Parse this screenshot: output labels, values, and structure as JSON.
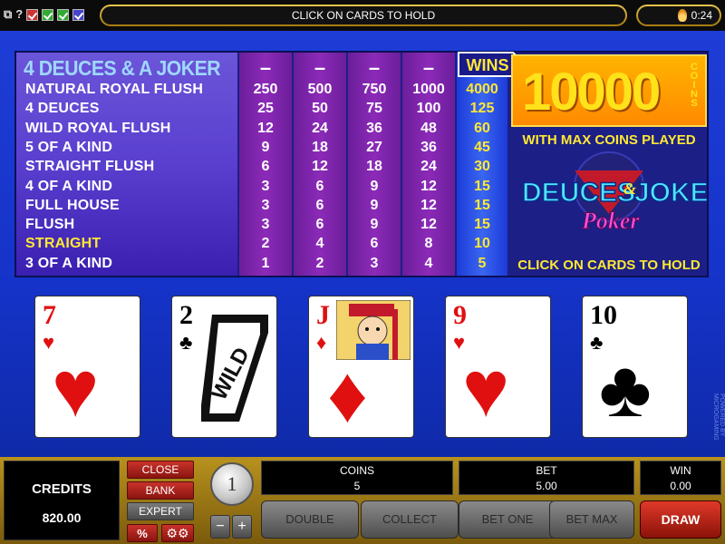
{
  "topbar": {
    "help_label": "?",
    "message": "CLICK ON CARDS TO HOLD",
    "time": "0:24"
  },
  "paytable": {
    "title": "4 DEUCES & A JOKER",
    "dash": "–",
    "wins_label": "WINS",
    "rows": [
      {
        "hand": "NATURAL ROYAL FLUSH",
        "c1": "250",
        "c2": "500",
        "c3": "750",
        "c4": "1000",
        "win": "4000"
      },
      {
        "hand": "4 DEUCES",
        "c1": "25",
        "c2": "50",
        "c3": "75",
        "c4": "100",
        "win": "125"
      },
      {
        "hand": "WILD ROYAL FLUSH",
        "c1": "12",
        "c2": "24",
        "c3": "36",
        "c4": "48",
        "win": "60"
      },
      {
        "hand": "5 OF A KIND",
        "c1": "9",
        "c2": "18",
        "c3": "27",
        "c4": "36",
        "win": "45"
      },
      {
        "hand": "STRAIGHT FLUSH",
        "c1": "6",
        "c2": "12",
        "c3": "18",
        "c4": "24",
        "win": "30"
      },
      {
        "hand": "4 OF A KIND",
        "c1": "3",
        "c2": "6",
        "c3": "9",
        "c4": "12",
        "win": "15"
      },
      {
        "hand": "FULL HOUSE",
        "c1": "3",
        "c2": "6",
        "c3": "9",
        "c4": "12",
        "win": "15"
      },
      {
        "hand": "FLUSH",
        "c1": "3",
        "c2": "6",
        "c3": "9",
        "c4": "12",
        "win": "15"
      },
      {
        "hand": "STRAIGHT",
        "c1": "2",
        "c2": "4",
        "c3": "6",
        "c4": "8",
        "win": "10"
      },
      {
        "hand": "3 OF A KIND",
        "c1": "1",
        "c2": "2",
        "c3": "3",
        "c4": "4",
        "win": "5"
      }
    ],
    "highlight_color": "#ffe833"
  },
  "side": {
    "jackpot": "10000",
    "coins_word": "COINS",
    "max_coins": "WITH MAX COINS PLAYED",
    "logo_line1": "DEUCES",
    "logo_amp": "&",
    "logo_line2": "JOKER",
    "logo_line3": "Poker",
    "hold_message": "CLICK ON CARDS TO HOLD"
  },
  "cards": [
    {
      "rank": "7",
      "suit": "♥",
      "color": "red",
      "name": "seven-of-hearts"
    },
    {
      "rank": "2",
      "suit": "♣",
      "color": "black",
      "name": "two-of-clubs-wild",
      "wild_text": "WILD"
    },
    {
      "rank": "J",
      "suit": "♦",
      "color": "red",
      "name": "jack-of-diamonds"
    },
    {
      "rank": "9",
      "suit": "♥",
      "color": "red",
      "name": "nine-of-hearts"
    },
    {
      "rank": "10",
      "suit": "♣",
      "color": "black",
      "name": "ten-of-clubs"
    }
  ],
  "watermark": "POWERED BY MICROGAMING",
  "controls": {
    "credits_label": "CREDITS",
    "credits_value": "820.00",
    "close": "CLOSE",
    "bank": "BANK",
    "expert": "EXPERT",
    "percent": "%",
    "gear_icon": "gear-icon",
    "coin_value": "1",
    "minus": "−",
    "plus": "+",
    "coins_label": "COINS",
    "coins_value": "5",
    "bet_label": "BET",
    "bet_value": "5.00",
    "win_label": "WIN",
    "win_value": "0.00",
    "double": "DOUBLE",
    "collect": "COLLECT",
    "bet_one": "BET ONE",
    "bet_max": "BET MAX",
    "draw": "DRAW"
  }
}
